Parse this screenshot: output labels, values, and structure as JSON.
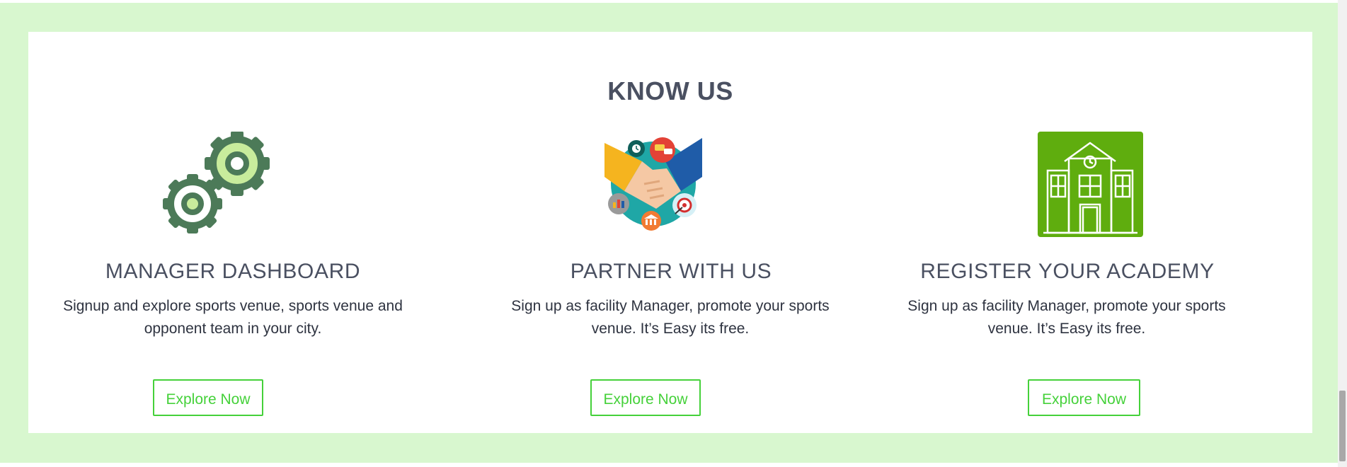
{
  "section": {
    "title": "KNOW US"
  },
  "cards": [
    {
      "title": "MANAGER DASHBOARD",
      "description": "Signup and explore sports venue, sports venue and opponent team in your city.",
      "button": "Explore Now",
      "icon": "gears-icon"
    },
    {
      "title": "PARTNER WITH US",
      "description": "Sign up as facility Manager, promote your sports venue. It’s Easy its free.",
      "button": "Explore Now",
      "icon": "handshake-icon"
    },
    {
      "title": "REGISTER YOUR ACADEMY",
      "description": "Sign up as facility Manager, promote your sports venue. It’s Easy its free.",
      "button": "Explore Now",
      "icon": "school-building-icon"
    }
  ],
  "colors": {
    "frame": "#d8f7cf",
    "button_accent": "#45d13a",
    "heading": "#4a5061",
    "gear_dark": "#4c7a58",
    "gear_light": "#c8ec9c",
    "building_bg": "#5fad0e"
  }
}
